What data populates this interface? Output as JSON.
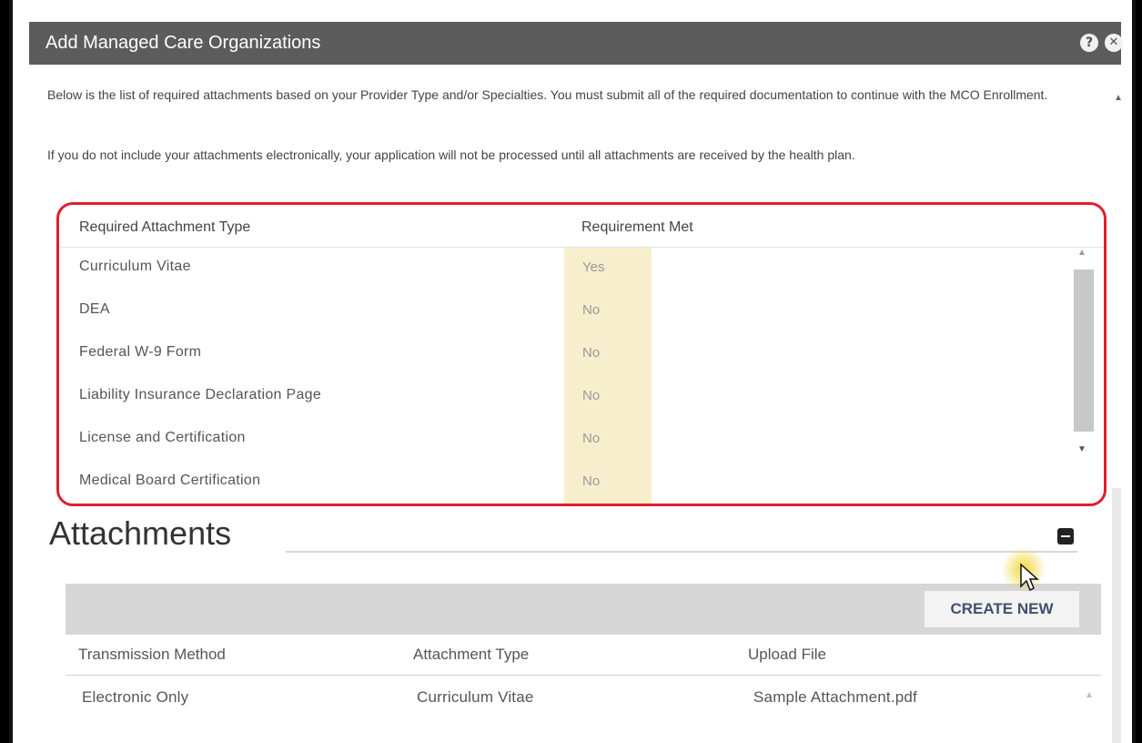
{
  "dialog": {
    "title": "Add Managed Care Organizations",
    "help_icon": "question-icon",
    "close_icon": "close-icon"
  },
  "intro": {
    "paragraph1": "Below is the list of required attachments based on your Provider Type and/or Specialties. You must submit all of the required documentation to continue with the MCO Enrollment.",
    "paragraph2": "If you do not include your attachments electronically, your application will not be processed until all attachments are received by the health plan."
  },
  "required_attachments": {
    "columns": [
      "Required Attachment Type",
      "Requirement Met"
    ],
    "rows": [
      {
        "type": "Curriculum Vitae",
        "met": "Yes"
      },
      {
        "type": "DEA",
        "met": "No"
      },
      {
        "type": "Federal W-9 Form",
        "met": "No"
      },
      {
        "type": "Liability Insurance Declaration Page",
        "met": "No"
      },
      {
        "type": "License and Certification",
        "met": "No"
      },
      {
        "type": "Medical Board Certification",
        "met": "No"
      }
    ],
    "highlight_color": "#f7eecd",
    "outline_color": "#e01e2e"
  },
  "attachments": {
    "title": "Attachments",
    "create_new_label": "CREATE NEW",
    "columns": [
      "Transmission Method",
      "Attachment Type",
      "Upload File"
    ],
    "rows": [
      {
        "method": "Electronic Only",
        "type": "Curriculum Vitae",
        "file": "Sample Attachment.pdf"
      }
    ]
  }
}
